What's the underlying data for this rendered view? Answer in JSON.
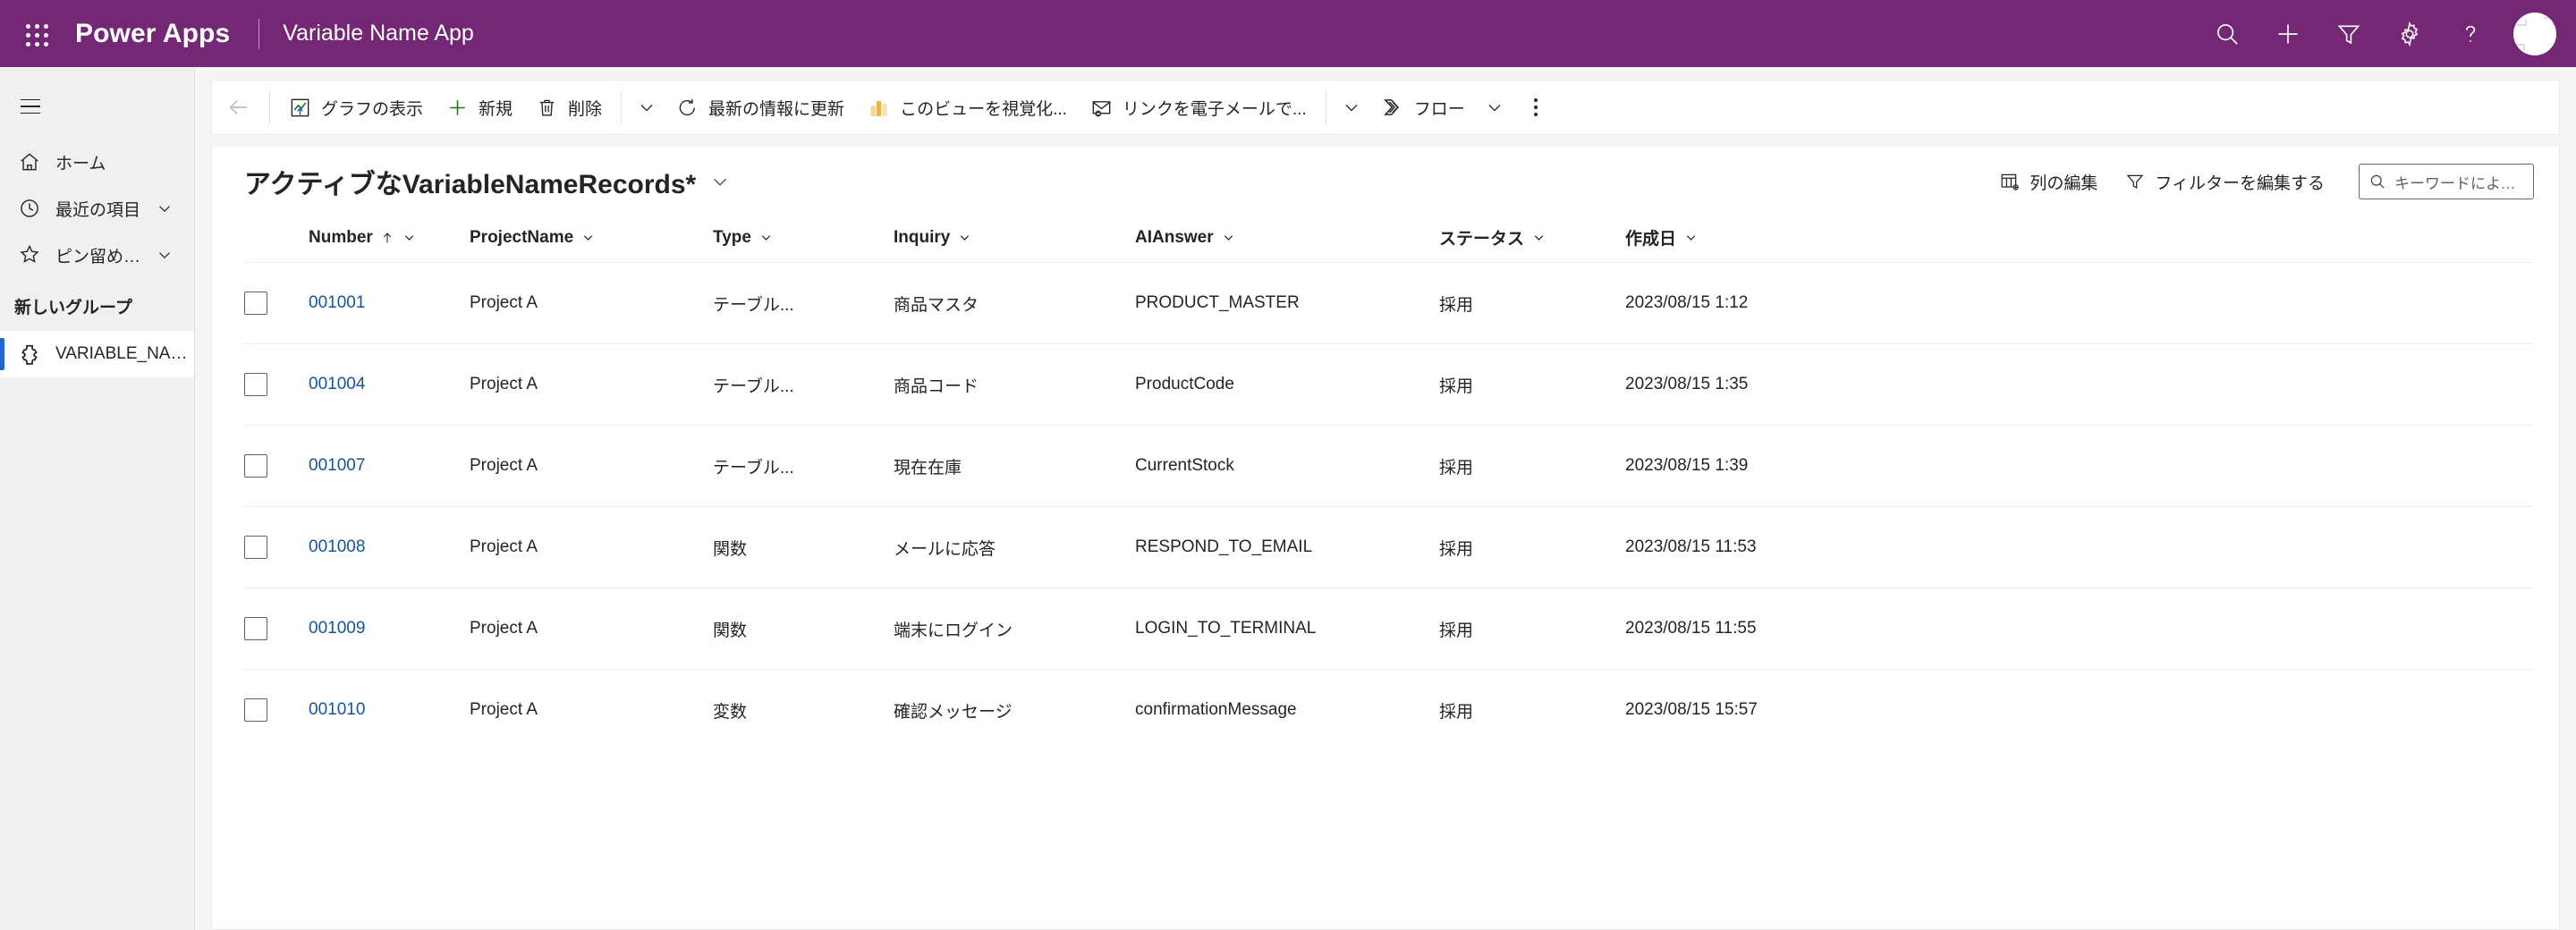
{
  "header": {
    "waffle_icon": "waffle-grid-icon",
    "brand": "Power Apps",
    "app_name": "Variable Name App",
    "actions": [
      {
        "name": "search-icon",
        "icon": "search"
      },
      {
        "name": "add-icon",
        "icon": "plus"
      },
      {
        "name": "filter-icon",
        "icon": "funnel"
      },
      {
        "name": "settings-icon",
        "icon": "gear"
      },
      {
        "name": "help-icon",
        "icon": "question"
      }
    ],
    "avatar": "user-avatar",
    "brand_color": "#742774"
  },
  "sidebar": {
    "hamburger": "hamburger-icon",
    "items": [
      {
        "label": "ホーム",
        "icon": "home",
        "has_chevron": false,
        "selected": false
      },
      {
        "label": "最近の項目",
        "icon": "clock",
        "has_chevron": true,
        "selected": false
      },
      {
        "label": "ピン留め済み",
        "icon": "pin",
        "has_chevron": true,
        "selected": false
      }
    ],
    "group_title": "新しいグループ",
    "group_items": [
      {
        "label": "VARIABLE_NAME_RE...",
        "icon": "entity",
        "selected": true
      }
    ],
    "accent_color": "#2266cc"
  },
  "commandbar": {
    "back": "back-arrow",
    "buttons": [
      {
        "label": "グラフの表示",
        "icon": "chart"
      },
      {
        "label": "新規",
        "icon": "plus-green"
      },
      {
        "label": "削除",
        "icon": "trash"
      }
    ],
    "caret_after_delete": "chevron-down",
    "buttons2": [
      {
        "label": "最新の情報に更新",
        "icon": "refresh"
      },
      {
        "label": "このビューを視覚化...",
        "icon": "powerbi"
      },
      {
        "label": "リンクを電子メールで...",
        "icon": "email-link"
      }
    ],
    "caret_2": "chevron-down",
    "flow": {
      "label": "フロー",
      "icon": "flow",
      "caret": "chevron-down"
    },
    "overflow": "more-vertical"
  },
  "listheader": {
    "view_title": "アクティブなVariableNameRecords*",
    "view_caret": "chevron-down",
    "edit_columns": "列の編集",
    "edit_filters": "フィルターを編集する",
    "search_placeholder": "キーワードによるフ..."
  },
  "table": {
    "columns": [
      {
        "key": "check",
        "label": ""
      },
      {
        "key": "number",
        "label": "Number",
        "sorted": "asc"
      },
      {
        "key": "project",
        "label": "ProjectName"
      },
      {
        "key": "type",
        "label": "Type"
      },
      {
        "key": "inquiry",
        "label": "Inquiry"
      },
      {
        "key": "ai",
        "label": "AIAnswer"
      },
      {
        "key": "status",
        "label": "ステータス"
      },
      {
        "key": "created",
        "label": "作成日"
      }
    ],
    "rows": [
      {
        "number": "001001",
        "project": "Project A",
        "type": "テーブル...",
        "inquiry": "商品マスタ",
        "ai": "PRODUCT_MASTER",
        "status": "採用",
        "created": "2023/08/15 1:12"
      },
      {
        "number": "001004",
        "project": "Project A",
        "type": "テーブル...",
        "inquiry": "商品コード",
        "ai": "ProductCode",
        "status": "採用",
        "created": "2023/08/15 1:35"
      },
      {
        "number": "001007",
        "project": "Project A",
        "type": "テーブル...",
        "inquiry": "現在在庫",
        "ai": "CurrentStock",
        "status": "採用",
        "created": "2023/08/15 1:39"
      },
      {
        "number": "001008",
        "project": "Project A",
        "type": "関数",
        "inquiry": "メールに応答",
        "ai": "RESPOND_TO_EMAIL",
        "status": "採用",
        "created": "2023/08/15 11:53"
      },
      {
        "number": "001009",
        "project": "Project A",
        "type": "関数",
        "inquiry": "端末にログイン",
        "ai": "LOGIN_TO_TERMINAL",
        "status": "採用",
        "created": "2023/08/15 11:55"
      },
      {
        "number": "001010",
        "project": "Project A",
        "type": "変数",
        "inquiry": "確認メッセージ",
        "ai": "confirmationMessage",
        "status": "採用",
        "created": "2023/08/15 15:57"
      }
    ]
  }
}
